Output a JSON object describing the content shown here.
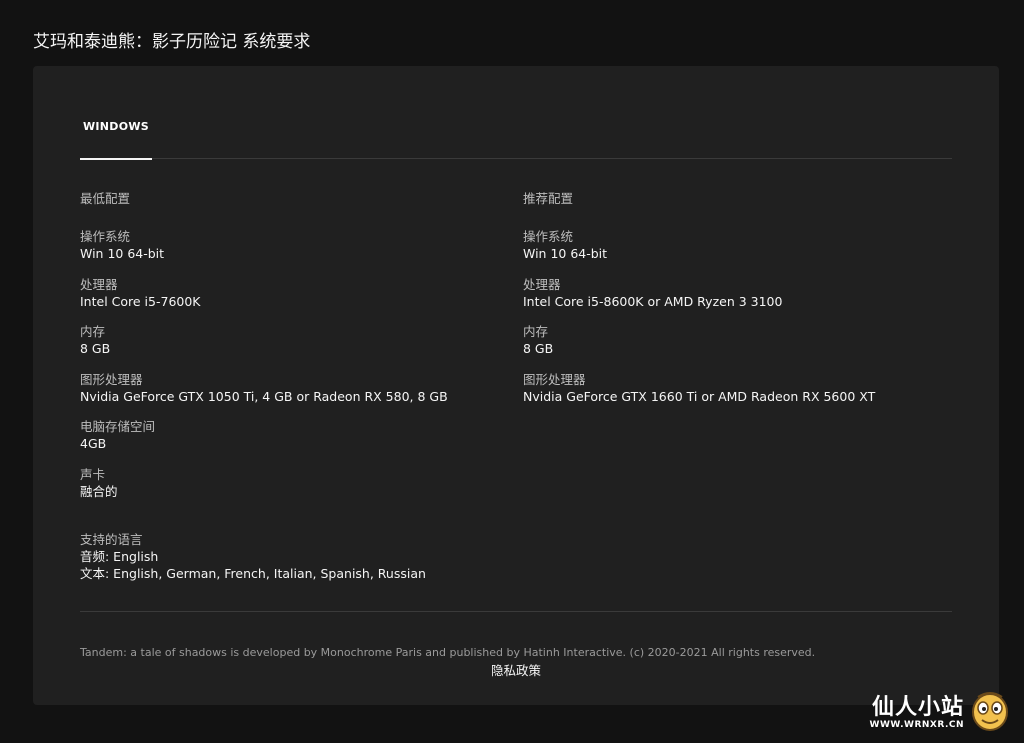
{
  "page_title": "艾玛和泰迪熊：影子历险记 系统要求",
  "tabs": [
    {
      "label": "WINDOWS",
      "active": true
    }
  ],
  "minimum": {
    "heading": "最低配置",
    "specs": [
      {
        "label": "操作系统",
        "value": "Win 10 64-bit"
      },
      {
        "label": "处理器",
        "value": "Intel Core i5-7600K"
      },
      {
        "label": "内存",
        "value": "8 GB"
      },
      {
        "label": "图形处理器",
        "value": "Nvidia GeForce GTX 1050 Ti, 4 GB or Radeon RX 580, 8 GB"
      },
      {
        "label": "电脑存储空间",
        "value": "4GB"
      },
      {
        "label": "声卡",
        "value": "融合的"
      }
    ]
  },
  "recommended": {
    "heading": "推荐配置",
    "specs": [
      {
        "label": "操作系统",
        "value": "Win 10 64-bit"
      },
      {
        "label": "处理器",
        "value": "Intel Core i5-8600K or AMD Ryzen 3 3100"
      },
      {
        "label": "内存",
        "value": "8 GB"
      },
      {
        "label": "图形处理器",
        "value": "Nvidia GeForce GTX 1660 Ti or AMD Radeon RX 5600 XT"
      }
    ]
  },
  "languages": {
    "label": "支持的语言",
    "audio": "音频: English",
    "text": "文本: English, German, French, Italian, Spanish, Russian"
  },
  "footer": {
    "copyright": "Tandem: a tale of shadows is developed by Monochrome Paris and published by Hatinh Interactive. (c) 2020-2021 All rights reserved.",
    "privacy_link": "隐私政策"
  },
  "watermark": {
    "title": "仙人小站",
    "subtitle": "WWW.WRNXR.CN",
    "mascot_icon": "cartoon-face-icon"
  },
  "colors": {
    "background": "#121212",
    "panel": "#202020",
    "divider": "#3a3a3a",
    "label": "#bdbdbd",
    "value": "#f5f5f5"
  }
}
